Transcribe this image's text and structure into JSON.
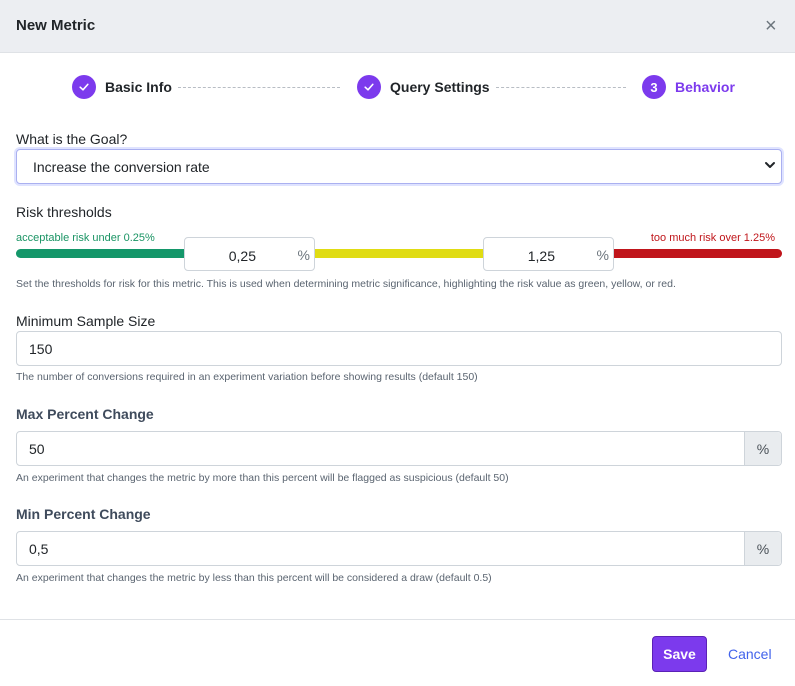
{
  "modal": {
    "title": "New Metric",
    "close_symbol": "×"
  },
  "steps": [
    {
      "label": "Basic Info",
      "state": "complete",
      "icon": "check-icon"
    },
    {
      "label": "Query Settings",
      "state": "complete",
      "icon": "check-icon"
    },
    {
      "number": "3",
      "label": "Behavior",
      "state": "active"
    }
  ],
  "goal": {
    "label": "What is the Goal?",
    "value": "Increase the conversion rate"
  },
  "risk": {
    "label": "Risk thresholds",
    "acceptable_text": "acceptable risk under 0.25%",
    "too_much_text": "too much risk over 1.25%",
    "low_value": "0,25",
    "high_value": "1,25",
    "unit": "%",
    "help": "Set the thresholds for risk for this metric. This is used when determining metric significance, highlighting the risk value as green, yellow, or red.",
    "colors": {
      "green": "#14976a",
      "yellow": "#e0dc13",
      "red": "#c0151b"
    }
  },
  "min_sample": {
    "label": "Minimum Sample Size",
    "value": "150",
    "help": "The number of conversions required in an experiment variation before showing results (default 150)"
  },
  "max_change": {
    "label": "Max Percent Change",
    "value": "50",
    "unit": "%",
    "help": "An experiment that changes the metric by more than this percent will be flagged as suspicious (default 50)"
  },
  "min_change": {
    "label": "Min Percent Change",
    "value": "0,5",
    "unit": "%",
    "help": "An experiment that changes the metric by less than this percent will be considered a draw (default 0.5)"
  },
  "footer": {
    "save_label": "Save",
    "cancel_label": "Cancel"
  },
  "accent_color": "#7c3aed"
}
